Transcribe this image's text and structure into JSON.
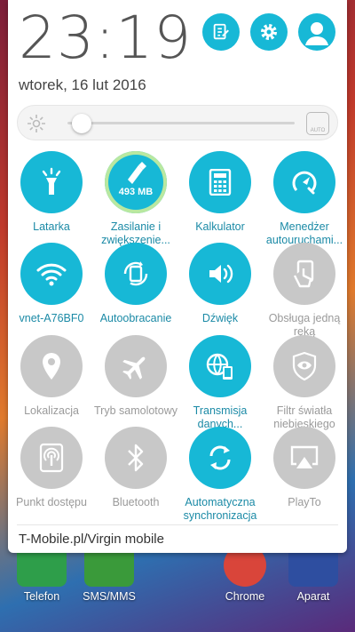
{
  "header": {
    "time": "23:19",
    "date": "wtorek, 16 lut 2016"
  },
  "brightness": {
    "level": 0.05,
    "auto_label": "AUTO"
  },
  "tiles": [
    {
      "label": "Latarka",
      "on": true,
      "icon": "flashlight-icon"
    },
    {
      "label": "Zasilanie i zwiększenie...",
      "on": true,
      "icon": "boost-icon",
      "extra": "493 MB"
    },
    {
      "label": "Kalkulator",
      "on": true,
      "icon": "calculator-icon"
    },
    {
      "label": "Menedżer autouruchami...",
      "on": true,
      "icon": "auto-start-icon"
    },
    {
      "label": "vnet-A76BF0",
      "on": true,
      "icon": "wifi-icon"
    },
    {
      "label": "Autoobracanie",
      "on": true,
      "icon": "auto-rotate-icon"
    },
    {
      "label": "Dźwięk",
      "on": true,
      "icon": "sound-icon"
    },
    {
      "label": "Obsługa jedną ręką",
      "on": false,
      "icon": "one-hand-icon"
    },
    {
      "label": "Lokalizacja",
      "on": false,
      "icon": "location-icon"
    },
    {
      "label": "Tryb samolotowy",
      "on": false,
      "icon": "airplane-icon"
    },
    {
      "label": "Transmisja danych...",
      "on": true,
      "icon": "mobile-data-icon"
    },
    {
      "label": "Filtr światła niebieskiego",
      "on": false,
      "icon": "eye-icon"
    },
    {
      "label": "Punkt dostępu",
      "on": false,
      "icon": "hotspot-icon"
    },
    {
      "label": "Bluetooth",
      "on": false,
      "icon": "bluetooth-icon"
    },
    {
      "label": "Automatyczna synchronizacja",
      "on": true,
      "icon": "sync-icon"
    },
    {
      "label": "PlayTo",
      "on": false,
      "icon": "playto-icon"
    }
  ],
  "carrier": "T-Mobile.pl/Virgin mobile",
  "dock": [
    {
      "label": "Telefon",
      "color": "#2e9e4a"
    },
    {
      "label": "SMS/MMS",
      "color": "#3a9a3a"
    },
    {
      "label": "",
      "color": "#b0b0b0"
    },
    {
      "label": "Chrome",
      "color": "#d9453a"
    },
    {
      "label": "Aparat",
      "color": "#2e4ea0"
    }
  ]
}
